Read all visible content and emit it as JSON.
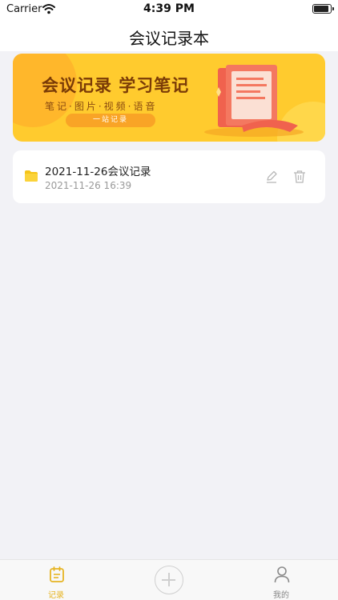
{
  "status_bar": {
    "carrier": "Carrier",
    "time": "4:39 PM"
  },
  "nav": {
    "title": "会议记录本"
  },
  "banner": {
    "headline": "会议记录 学习笔记",
    "subtitle": "笔记·图片·视频·语音",
    "pill_label": "一站记录"
  },
  "records": [
    {
      "title": "2021-11-26会议记录",
      "time": "2021-11-26 16:39"
    }
  ],
  "tab_bar": {
    "records_label": "记录",
    "mine_label": "我的"
  },
  "colors": {
    "accent": "#e6b422",
    "banner_bg": "#ffcb2e",
    "background": "#f2f2f6"
  },
  "icons": [
    "wifi-icon",
    "battery-icon",
    "folder-icon",
    "edit-icon",
    "delete-icon",
    "records-tab-icon",
    "add-icon",
    "profile-icon"
  ]
}
